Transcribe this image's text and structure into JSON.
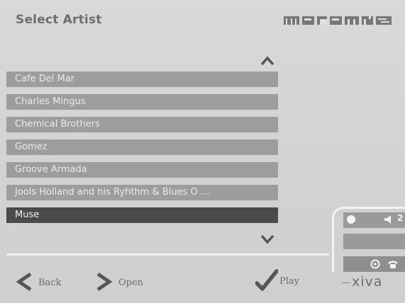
{
  "header": {
    "title": "Select Artist",
    "brand": "marantz"
  },
  "list": {
    "items": [
      "Cafe Del Mar",
      "Charles Mingus",
      "Chemical Brothers",
      "Gomez",
      "Groove Armada",
      "Jools Holland and his Ryhthm & Blues O ...",
      "Muse"
    ],
    "selected_index": 6,
    "scroll_up_icon": "chevron-up",
    "scroll_down_icon": "chevron-down"
  },
  "status_panel": {
    "volume_value": "2",
    "icons": [
      "record-dot",
      "volume-speaker",
      "settings-gear",
      "phone"
    ]
  },
  "toolbar": {
    "back_label": "Back",
    "open_label": "Open",
    "play_label": "Play"
  },
  "footer": {
    "logo": "xiva"
  },
  "colors": {
    "background": "#d6d6d6",
    "list_item": "#9d9d9d",
    "list_item_selected": "#4a4a4a",
    "text_light": "#ebebeb",
    "text_dark": "#6e6e6e"
  }
}
